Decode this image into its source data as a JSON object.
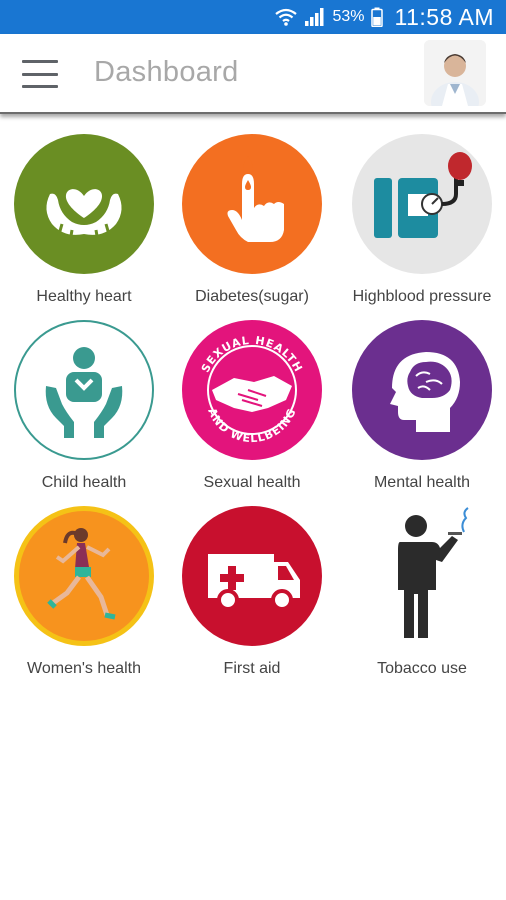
{
  "status_bar": {
    "battery_percent": "53%",
    "time": "11:58 AM",
    "icons": [
      "wifi-icon",
      "signal-icon",
      "battery-icon"
    ]
  },
  "app_bar": {
    "title": "Dashboard",
    "menu_icon": "hamburger-menu-icon",
    "avatar_icon": "doctor-avatar"
  },
  "tiles": [
    {
      "label": "Healthy heart",
      "icon": "heart-hands-icon",
      "color": "#6a8e23"
    },
    {
      "label": "Diabetes(sugar)",
      "icon": "finger-blood-drop-icon",
      "color": "#f36f21"
    },
    {
      "label": "Highblood pressure",
      "icon": "blood-pressure-monitor-icon",
      "color": "#e6e6e6"
    },
    {
      "label": "Child health",
      "icon": "child-in-hands-icon",
      "color": "#ffffff"
    },
    {
      "label": "Sexual health",
      "icon": "sexual-health-handshake-icon",
      "color": "#e3147c"
    },
    {
      "label": "Mental health",
      "icon": "brain-head-icon",
      "color": "#6b2f8f"
    },
    {
      "label": "Women's health",
      "icon": "running-woman-icon",
      "color": "#f7931e"
    },
    {
      "label": "First aid",
      "icon": "ambulance-icon",
      "color": "#c8102e"
    },
    {
      "label": "Tobacco use",
      "icon": "smoking-man-icon",
      "color": "#ffffff"
    }
  ],
  "sexual_health_badge": {
    "top_text": "SEXUAL HEALTH",
    "bottom_text": "AND WELLBEING"
  },
  "colors": {
    "status_bar": "#1976d2",
    "title_text": "#a8a8a8",
    "label_text": "#444444"
  }
}
